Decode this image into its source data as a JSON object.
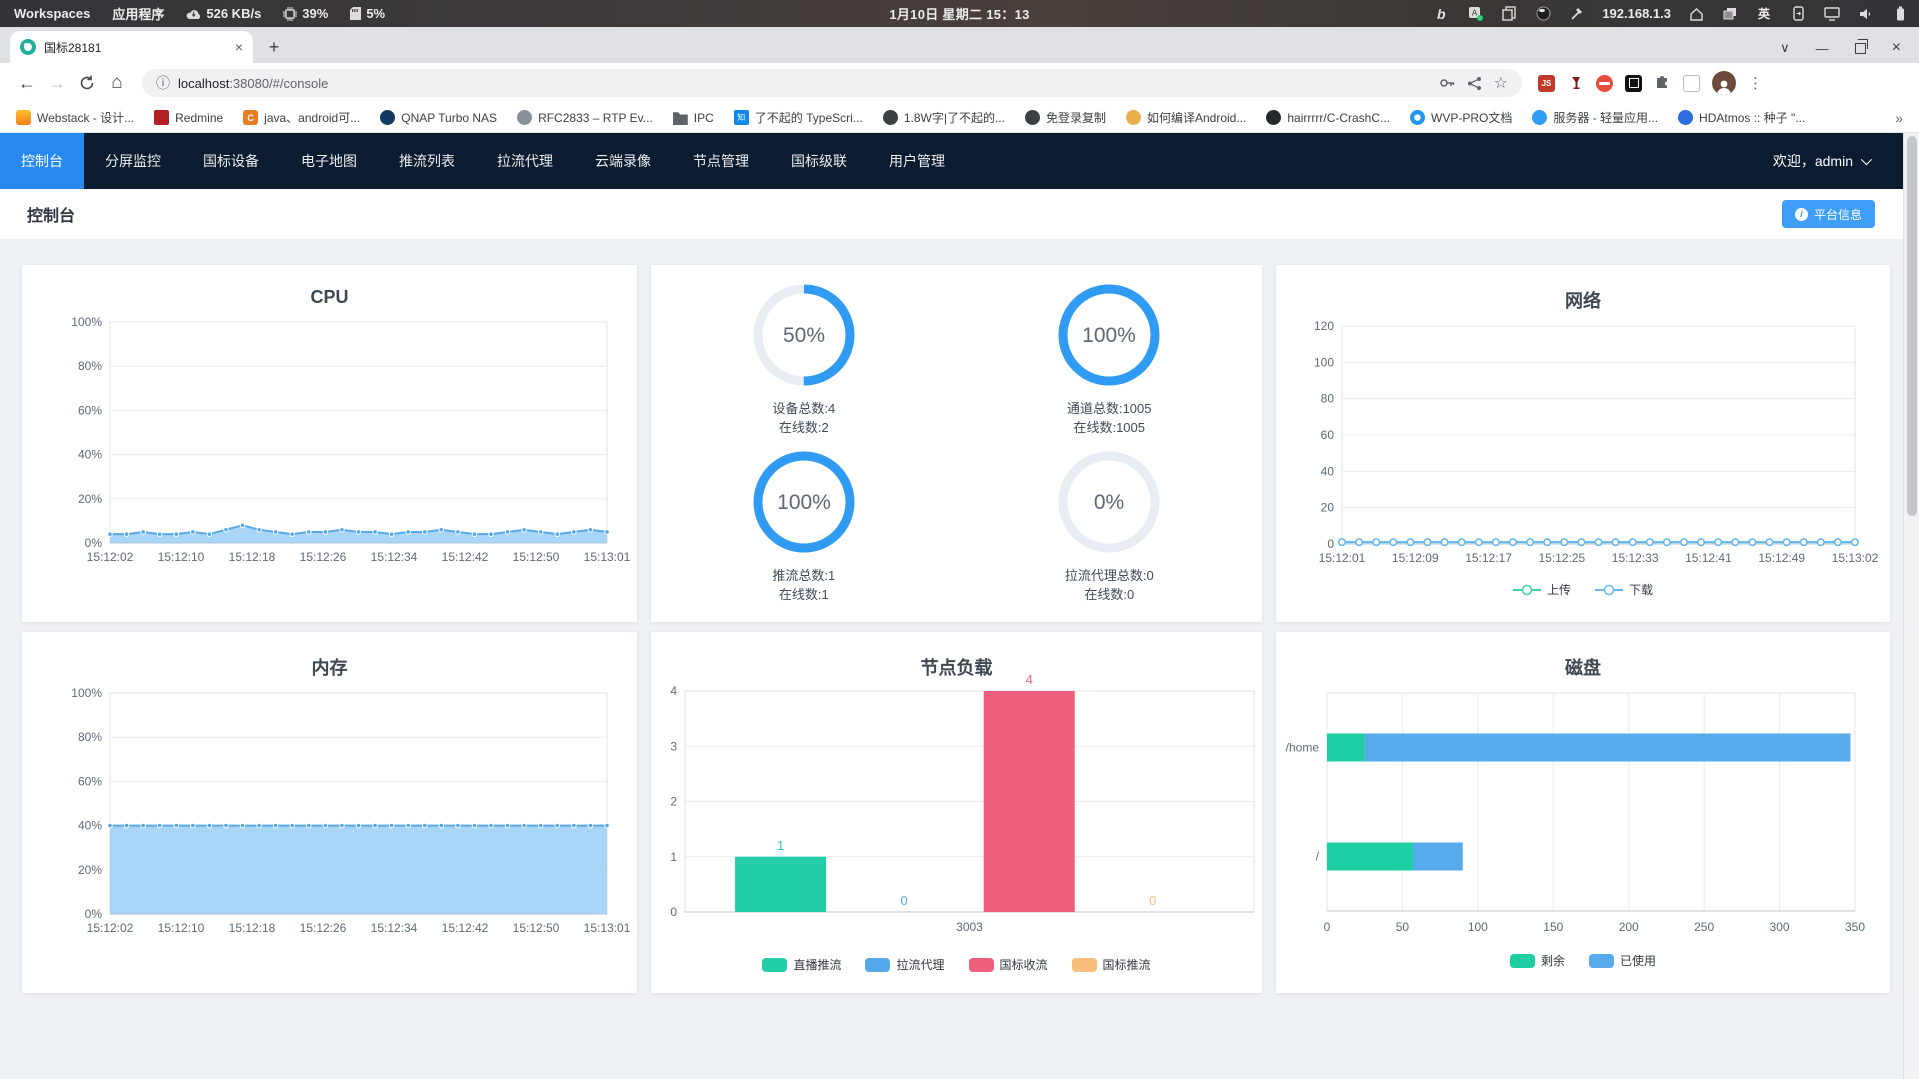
{
  "system_bar": {
    "workspaces": "Workspaces",
    "applications": "应用程序",
    "net_speed": "526 KB/s",
    "cpu_usage": "39%",
    "mem_usage": "5%",
    "clock": "1月10日 星期二 15：13",
    "ip_address": "192.168.1.3",
    "ime": "英",
    "tray_b": "b"
  },
  "browser": {
    "tab_title": "国标28181",
    "url_host": "localhost",
    "url_rest": ":38080/#/console",
    "icons": {
      "back": "←",
      "forward": "→",
      "home": "⌂",
      "info": "ⓘ",
      "star": "☆",
      "menu": "⋮",
      "close_tab": "×",
      "new_tab": "+",
      "overflow": "»",
      "win_min": "—",
      "win_close": "×",
      "win_menu": "∨",
      "js_badge": "JS"
    },
    "bookmarks": [
      {
        "label": "Webstack - 设计...",
        "icon": "webstack"
      },
      {
        "label": "Redmine",
        "icon": "redmine"
      },
      {
        "label": "java、android可...",
        "icon": "c-orange"
      },
      {
        "label": "QNAP Turbo NAS",
        "icon": "qnap"
      },
      {
        "label": "RFC2833 – RTP Ev...",
        "icon": "rfc"
      },
      {
        "label": "IPC",
        "icon": "folder"
      },
      {
        "label": "了不起的 TypeScri...",
        "icon": "zhihu"
      },
      {
        "label": "1.8W字|了不起的...",
        "icon": "dark-globe"
      },
      {
        "label": "免登录复制",
        "icon": "dark-globe"
      },
      {
        "label": "如何编译Android...",
        "icon": "person"
      },
      {
        "label": "hairrrrr/C-CrashC...",
        "icon": "github"
      },
      {
        "label": "WVP-PRO文档",
        "icon": "wvp"
      },
      {
        "label": "服务器 - 轻量应用...",
        "icon": "cloud"
      },
      {
        "label": "HDAtmos :: 种子 \"...",
        "icon": "hd"
      }
    ]
  },
  "app": {
    "nav": {
      "items": [
        "控制台",
        "分屏监控",
        "国标设备",
        "电子地图",
        "推流列表",
        "拉流代理",
        "云端录像",
        "节点管理",
        "国标级联",
        "用户管理"
      ],
      "active_index": 0,
      "welcome": "欢迎，admin"
    },
    "header": {
      "title": "控制台",
      "platform_info": "平台信息"
    }
  },
  "rings": {
    "color": "#2f9bf2",
    "track_color": "#e8edf3",
    "items": [
      {
        "percent": 50,
        "percent_label": "50%",
        "line1": "设备总数:4",
        "line2": "在线数:2"
      },
      {
        "percent": 100,
        "percent_label": "100%",
        "line1": "通道总数:1005",
        "line2": "在线数:1005"
      },
      {
        "percent": 100,
        "percent_label": "100%",
        "line1": "推流总数:1",
        "line2": "在线数:1"
      },
      {
        "percent": 0,
        "percent_label": "0%",
        "line1": "拉流代理总数:0",
        "line2": "在线数:0"
      }
    ]
  },
  "chart_data": [
    {
      "id": "cpu",
      "type": "area",
      "title": "CPU",
      "x_labels": [
        "15:12:02",
        "15:12:10",
        "15:12:18",
        "15:12:26",
        "15:12:34",
        "15:12:42",
        "15:12:50",
        "15:13:01"
      ],
      "values": [
        4,
        4,
        5,
        4,
        4,
        5,
        4,
        6,
        8,
        6,
        5,
        4,
        5,
        5,
        6,
        5,
        5,
        4,
        5,
        5,
        6,
        5,
        4,
        4,
        5,
        6,
        5,
        4,
        5,
        6,
        5
      ],
      "ylim": [
        0,
        100
      ],
      "yticks": [
        "0%",
        "20%",
        "40%",
        "60%",
        "80%",
        "100%"
      ],
      "line_color": "#57a8e9",
      "fill_color": "rgba(140,200,243,0.75)"
    },
    {
      "id": "network",
      "type": "line",
      "title": "网络",
      "x_labels": [
        "15:12:01",
        "15:12:09",
        "15:12:17",
        "15:12:25",
        "15:12:33",
        "15:12:41",
        "15:12:49",
        "15:13:02"
      ],
      "ylim": [
        0,
        120
      ],
      "yticks": [
        "0",
        "20",
        "40",
        "60",
        "80",
        "100",
        "120"
      ],
      "series": [
        {
          "name": "上传",
          "color": "#3fd2b4",
          "values": [
            1,
            1,
            1,
            1,
            1,
            1,
            1,
            1,
            1,
            1,
            1,
            1,
            1,
            1,
            1,
            1,
            1,
            1,
            1,
            1,
            1,
            1,
            1,
            1,
            1,
            1,
            1,
            1,
            1,
            1,
            1
          ]
        },
        {
          "name": "下载",
          "color": "#68b7f1",
          "values": [
            1,
            1,
            1,
            1,
            1,
            1,
            1,
            1,
            1,
            1,
            1,
            1,
            1,
            1,
            1,
            1,
            1,
            1,
            1,
            1,
            1,
            1,
            1,
            1,
            1,
            1,
            1,
            1,
            1,
            1,
            1
          ]
        }
      ],
      "legend_position": "bottom"
    },
    {
      "id": "memory",
      "type": "area",
      "title": "内存",
      "x_labels": [
        "15:12:02",
        "15:12:10",
        "15:12:18",
        "15:12:26",
        "15:12:34",
        "15:12:42",
        "15:12:50",
        "15:13:01"
      ],
      "values": [
        40,
        40,
        40,
        40,
        40,
        40,
        40,
        40,
        40,
        40,
        40,
        40,
        40,
        40,
        40,
        40,
        40,
        40,
        40,
        40,
        40,
        40,
        40,
        40,
        40,
        40,
        40,
        40,
        40,
        40,
        40
      ],
      "ylim": [
        0,
        100
      ],
      "yticks": [
        "0%",
        "20%",
        "40%",
        "60%",
        "80%",
        "100%"
      ],
      "line_color": "#57a8e9",
      "fill_color": "rgba(140,200,243,0.75)"
    },
    {
      "id": "nodeload",
      "type": "bar",
      "title": "节点负载",
      "category": "3003",
      "ylim": [
        0,
        4
      ],
      "yticks": [
        "0",
        "1",
        "2",
        "3",
        "4"
      ],
      "series": [
        {
          "name": "直播推流",
          "value": 1,
          "color": "#23cea6"
        },
        {
          "name": "拉流代理",
          "value": 0,
          "color": "#56a9e9"
        },
        {
          "name": "国标收流",
          "value": 4,
          "color": "#ee5f7d"
        },
        {
          "name": "国标推流",
          "value": 0,
          "color": "#f9bd7c"
        }
      ],
      "legend_position": "bottom"
    },
    {
      "id": "disk",
      "type": "hbar",
      "title": "磁盘",
      "categories": [
        "/home",
        "/"
      ],
      "xlim": [
        0,
        350
      ],
      "xticks": [
        0,
        50,
        100,
        150,
        200,
        250,
        300,
        350
      ],
      "series": [
        {
          "name": "剩余",
          "color": "#1ecfa4",
          "values": [
            25,
            57
          ]
        },
        {
          "name": "已使用",
          "color": "#57abec",
          "values": [
            322,
            33
          ]
        }
      ],
      "legend_position": "bottom"
    }
  ]
}
